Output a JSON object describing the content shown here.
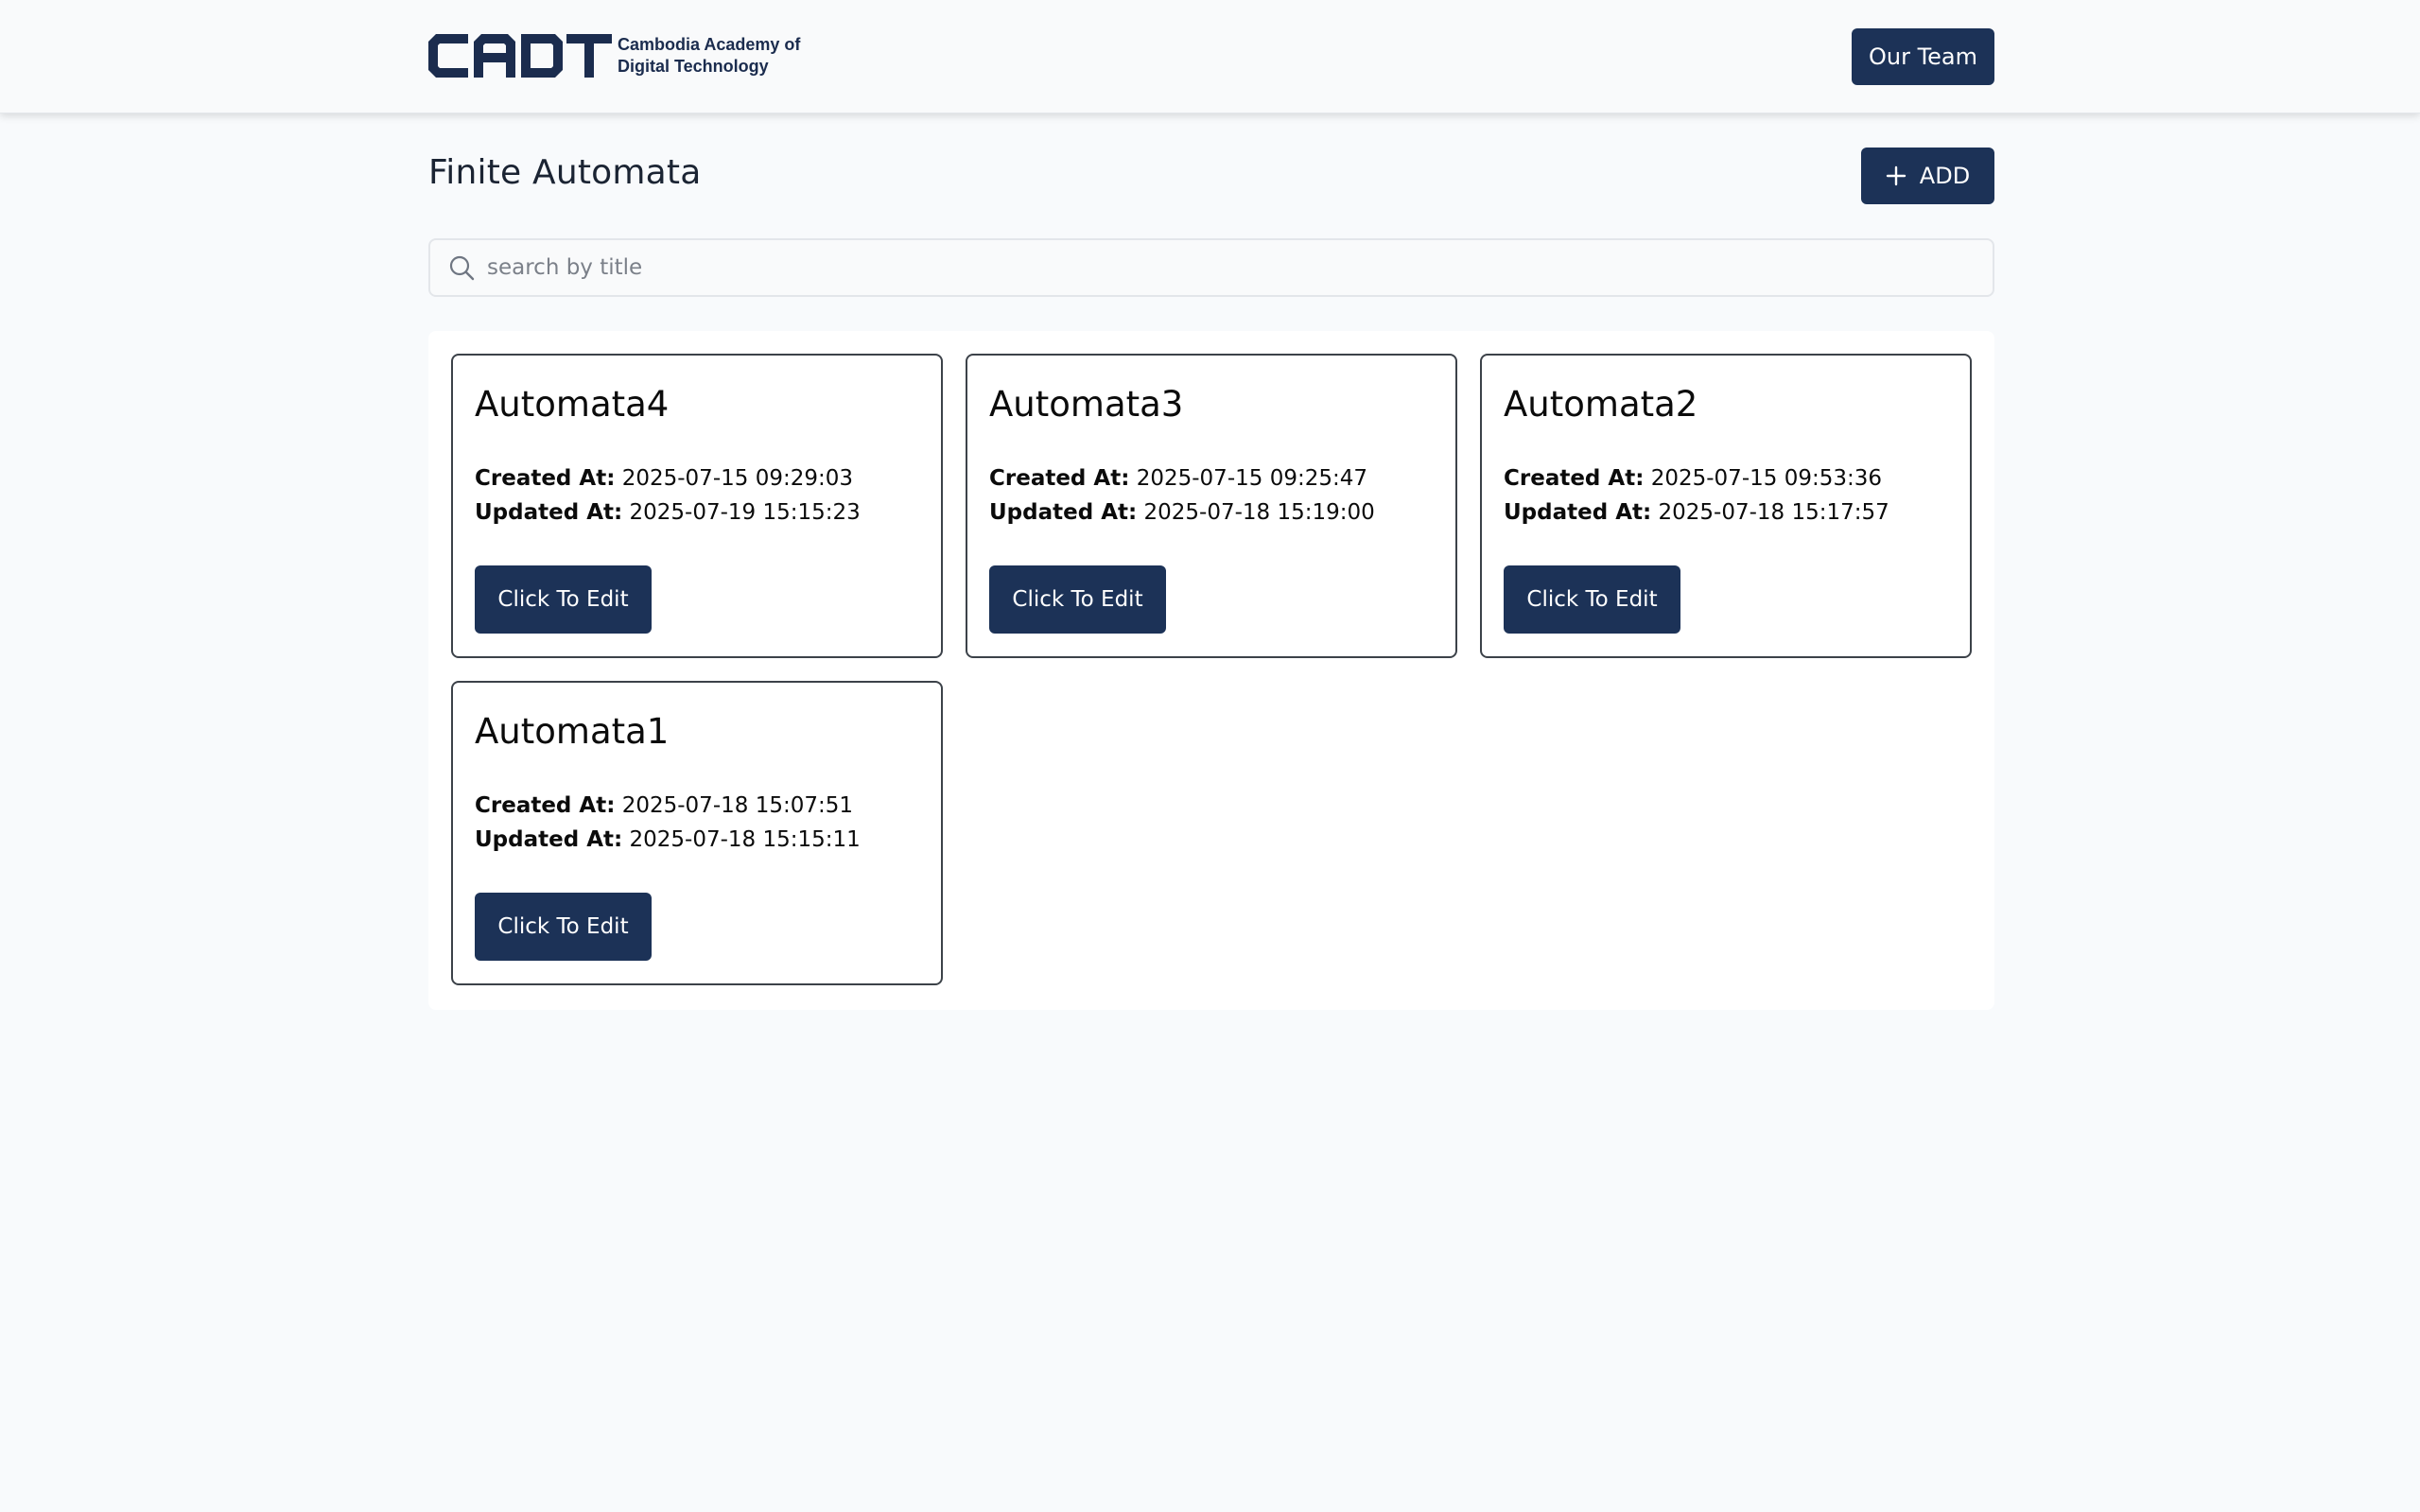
{
  "header": {
    "logo_mark": "CADT",
    "logo_line1": "Cambodia Academy of",
    "logo_line2": "Digital Technology",
    "team_button": "Our Team"
  },
  "page": {
    "title": "Finite Automata",
    "add_button": "ADD"
  },
  "search": {
    "placeholder": "search by title",
    "value": ""
  },
  "icons": {
    "search": "search-icon",
    "add": "plus-icon"
  },
  "colors": {
    "primary": "#1c3257",
    "background": "#f8fafc",
    "card_border": "#3c4249"
  },
  "cards": [
    {
      "title": "Automata4",
      "created_label": "Created At:",
      "created": "2025-07-15 09:29:03",
      "updated_label": "Updated At:",
      "updated": "2025-07-19 15:15:23",
      "button": "Click To Edit"
    },
    {
      "title": "Automata3",
      "created_label": "Created At:",
      "created": "2025-07-15 09:25:47",
      "updated_label": "Updated At:",
      "updated": "2025-07-18 15:19:00",
      "button": "Click To Edit"
    },
    {
      "title": "Automata2",
      "created_label": "Created At:",
      "created": "2025-07-15 09:53:36",
      "updated_label": "Updated At:",
      "updated": "2025-07-18 15:17:57",
      "button": "Click To Edit"
    },
    {
      "title": "Automata1",
      "created_label": "Created At:",
      "created": "2025-07-18 15:07:51",
      "updated_label": "Updated At:",
      "updated": "2025-07-18 15:15:11",
      "button": "Click To Edit"
    }
  ]
}
